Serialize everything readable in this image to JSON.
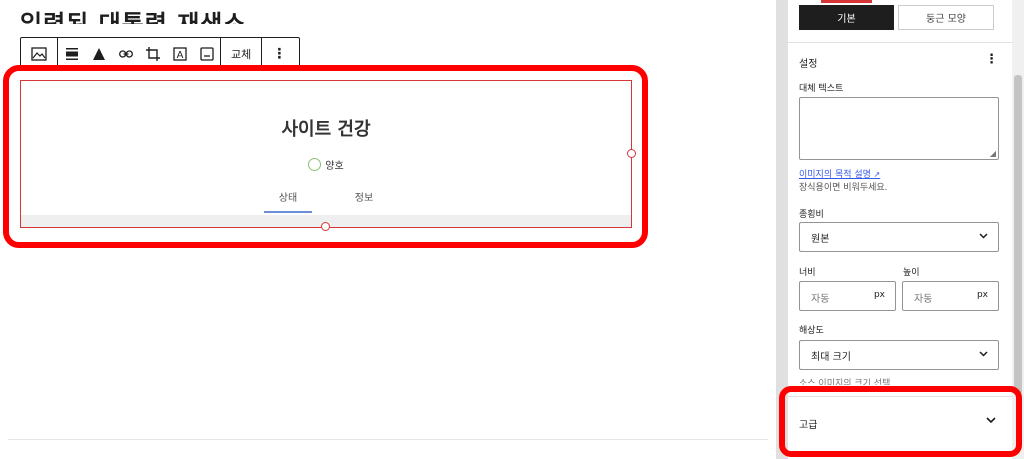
{
  "editor": {
    "heading_partial": "입력된 대통령 재생소",
    "toolbar": {
      "replace_label": "교체",
      "more_label": "⋮"
    },
    "image": {
      "title": "사이트 건강",
      "status_label": "양호",
      "tabs": [
        {
          "label": "상태",
          "active": true
        },
        {
          "label": "정보",
          "active": false
        }
      ]
    }
  },
  "sidebar": {
    "style_tabs": [
      {
        "label": "기본",
        "active": true
      },
      {
        "label": "둥근 모양",
        "active": false
      }
    ],
    "settings": {
      "title": "설정",
      "menu_label": "⋮",
      "alt_text_label": "대체 텍스트",
      "alt_text_value": "",
      "alt_help_link": "이미지의 목적 설명",
      "alt_help_text": "장식용이면 비워두세요.",
      "aspect_ratio_label": "종횡비",
      "aspect_ratio_value": "원본",
      "width_label": "너비",
      "height_label": "높이",
      "width_placeholder": "자동",
      "height_placeholder": "자동",
      "unit": "px",
      "resolution_label": "해상도",
      "resolution_value": "최대 크기",
      "resolution_help_partial": "소스 이미지의 크기 선택"
    },
    "advanced": {
      "label": "고급"
    }
  },
  "colors": {
    "highlight": "#ff0000",
    "selection": "#d63638",
    "link": "#3858e9",
    "status_good": "#8bbf72",
    "tab_active": "#6b8fd8"
  }
}
